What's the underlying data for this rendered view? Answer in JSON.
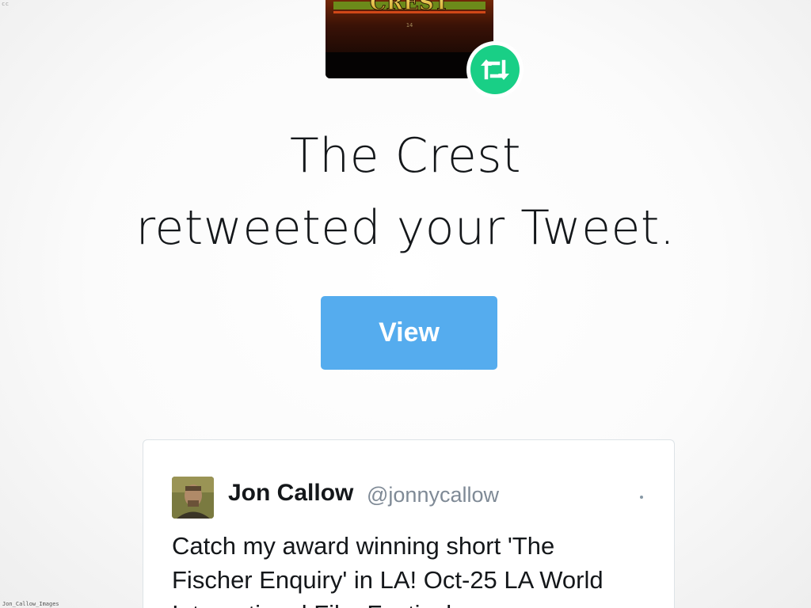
{
  "corner_tag": "cc",
  "watermark": "Jon_Callow_Images",
  "poster": {
    "title_text": "CREST",
    "sub_text": "14"
  },
  "retweet_badge": {
    "icon": "retweet-icon",
    "color": "#19cf86"
  },
  "notification": {
    "line1": "The Crest",
    "line2": "retweeted your Tweet."
  },
  "view_button": {
    "label": "View",
    "color": "#55acee"
  },
  "tweet": {
    "author_name": "Jon Callow",
    "author_handle": "@jonnycallow",
    "text_line1": "Catch my award winning short 'The",
    "text_line2": "Fischer Enquiry' in LA! Oct-25 LA World",
    "text_line3": "International Film Festival..."
  }
}
